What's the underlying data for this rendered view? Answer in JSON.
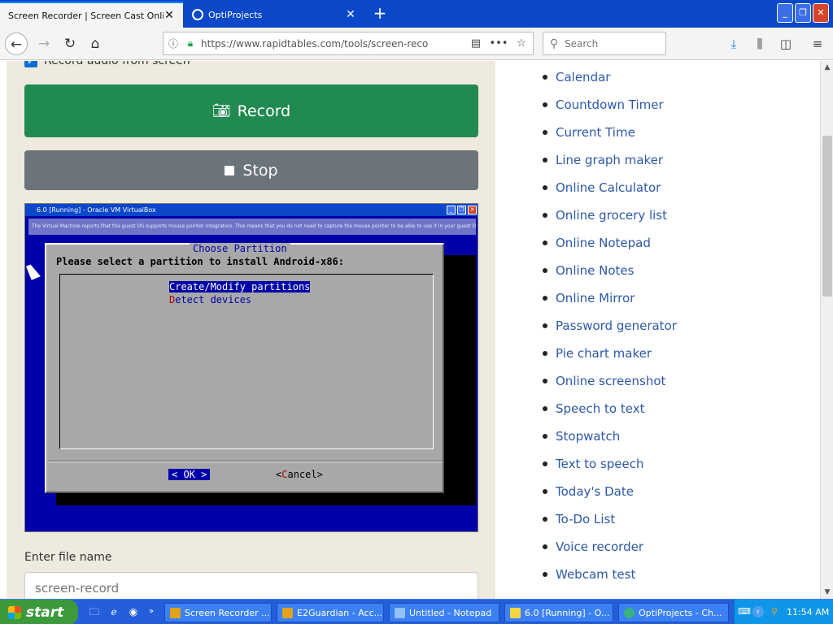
{
  "browser": {
    "tabs": [
      {
        "title": "Screen Recorder | Screen Cast Online",
        "active": true
      },
      {
        "title": "OptiProjects",
        "active": false
      }
    ],
    "url": "https://www.rapidtables.com/tools/screen-reco",
    "search_placeholder": "Search"
  },
  "page": {
    "record_audio_label": "Record audio from screen",
    "record_audio_checked": true,
    "record_button": "Record",
    "stop_button": "Stop",
    "file_name_label": "Enter file name",
    "file_name_placeholder": "screen-record"
  },
  "preview": {
    "window_title": "6.0 [Running] - Oracle VM VirtualBox",
    "notice": "The Virtual Machine reports that the guest OS supports mouse pointer integration. This means that you do not need to capture the mouse pointer to be able to use it in your guest OS -- all mouse",
    "dialog_title": "Choose Partition",
    "prompt": "Please select a partition to install Android-x86:",
    "options": [
      {
        "hotkey": "C",
        "rest": "reate/Modify partitions",
        "selected": true
      },
      {
        "hotkey": "D",
        "rest": "etect devices",
        "selected": false
      }
    ],
    "ok_label": "<  OK  >",
    "cancel_open": "<",
    "cancel_hotkey": "C",
    "cancel_rest": "ancel>"
  },
  "sidebar_links": [
    "Calendar",
    "Countdown Timer",
    "Current Time",
    "Line graph maker",
    "Online Calculator",
    "Online grocery list",
    "Online Notepad",
    "Online Notes",
    "Online Mirror",
    "Password generator",
    "Pie chart maker",
    "Online screenshot",
    "Speech to text",
    "Stopwatch",
    "Text to speech",
    "Today's Date",
    "To-Do List",
    "Voice recorder",
    "Webcam test"
  ],
  "taskbar": {
    "start_label": "start",
    "tasks": [
      "Screen Recorder ...",
      "E2Guardian - Acc...",
      "Untitled - Notepad",
      "6.0 [Running] - O...",
      "OptiProjects - Ch..."
    ],
    "clock": "11:54 AM"
  },
  "colors": {
    "record": "#218a50",
    "stop": "#6b737b",
    "link": "#2c58a8",
    "taskbar": "#245edb"
  }
}
